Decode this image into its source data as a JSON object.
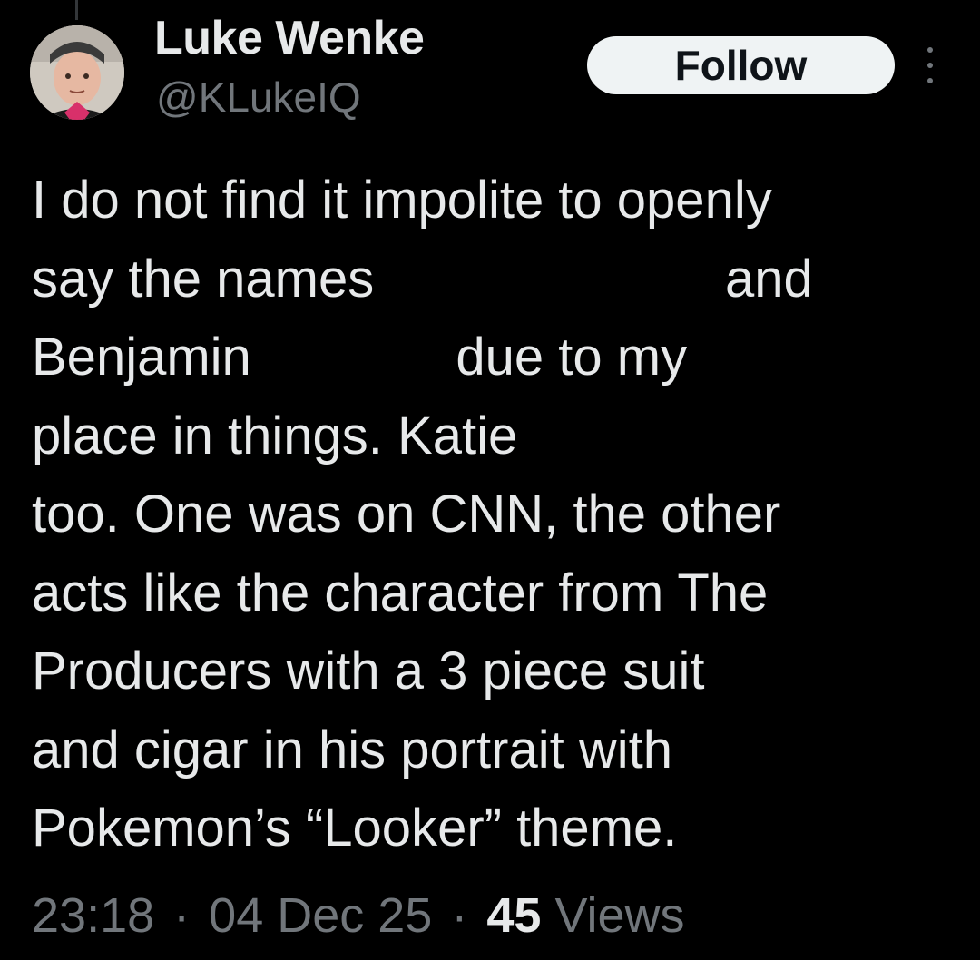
{
  "author": {
    "display_name": "Luke Wenke",
    "handle": "@KLukeIQ",
    "avatar_icon": "user-avatar-photo"
  },
  "actions": {
    "follow_label": "Follow",
    "more_icon": "more-vertical-icon"
  },
  "tweet": {
    "lines": [
      "I do not find it impolite to openly",
      "say the names                        and",
      "Benjamin              due to my",
      "place in things. Katie",
      "too. One was on CNN, the other",
      "acts like the character from The",
      "Producers with a 3 piece suit",
      "and cigar in his portrait with",
      "Pokemon’s “Looker” theme."
    ]
  },
  "meta": {
    "time": "23:18",
    "separator": "·",
    "date": "04 Dec 25",
    "views_count": "45",
    "views_label": "Views"
  },
  "colors": {
    "background": "#000000",
    "primary_text": "#e7e9ea",
    "secondary_text": "#71767b",
    "follow_bg": "#eff3f4",
    "follow_text": "#0f1419"
  }
}
